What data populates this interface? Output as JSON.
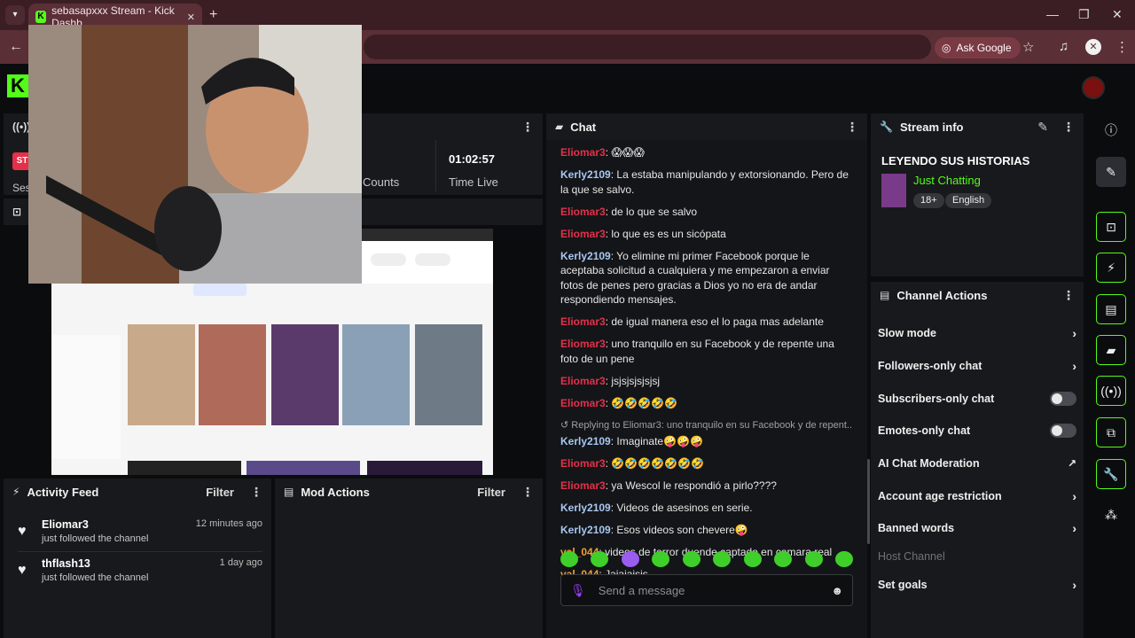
{
  "browser": {
    "tab_title": "sebasapxxx Stream - Kick Dashb",
    "ask_google": "Ask Google"
  },
  "session": {
    "badge": "ST",
    "label_left": "Ses",
    "counts_label": "Counts",
    "time_value": "01:02:57",
    "time_label": "Time Live"
  },
  "chat": {
    "title": "Chat",
    "messages": [
      {
        "user": "Eliomar3",
        "color": "red",
        "text": "😱😱😱"
      },
      {
        "user": "Kerly2109",
        "color": "blue",
        "text": "La estaba manipulando y extorsionando. Pero de la que se salvo."
      },
      {
        "user": "Eliomar3",
        "color": "red",
        "text": "de lo que se salvo"
      },
      {
        "user": "Eliomar3",
        "color": "red",
        "text": "lo que es es un sicópata"
      },
      {
        "user": "Kerly2109",
        "color": "blue",
        "text": "Yo elimine mi primer Facebook porque le aceptaba solicitud a cualquiera y me empezaron a enviar fotos de penes pero gracias a Dios yo no era de andar respondiendo mensajes."
      },
      {
        "user": "Eliomar3",
        "color": "red",
        "text": "de igual manera eso el lo paga mas adelante"
      },
      {
        "user": "Eliomar3",
        "color": "red",
        "text": "uno tranquilo en su Facebook y de repente una foto de un pene"
      },
      {
        "user": "Eliomar3",
        "color": "red",
        "text": "jsjsjsjsjsjsj"
      },
      {
        "user": "Eliomar3",
        "color": "red",
        "text": "🤣🤣🤣🤣🤣"
      },
      {
        "reply": "Replying to Eliomar3: uno tranquilo en su Facebook y de repent...",
        "user": "Kerly2109",
        "color": "blue",
        "text": "Imaginate🤪🤪🤪"
      },
      {
        "user": "Eliomar3",
        "color": "red",
        "text": "🤣🤣🤣🤣🤣🤣🤣"
      },
      {
        "user": "Eliomar3",
        "color": "red",
        "text": "ya Wescol le respondió a pirlo????"
      },
      {
        "user": "Kerly2109",
        "color": "blue",
        "text": "Videos de asesinos en serie."
      },
      {
        "user": "Kerly2109",
        "color": "blue",
        "text": "Esos videos son chevere🤪"
      },
      {
        "user": "val_044",
        "color": "orange",
        "text": "videos de terror duende captado en camara real"
      },
      {
        "user": "val_044",
        "color": "orange",
        "text": "Jajajajsjs"
      }
    ],
    "input_placeholder": "Send a message"
  },
  "stream_info": {
    "title": "Stream info",
    "stream_title": "LEYENDO SUS HISTORIAS",
    "category": "Just Chatting",
    "tags": [
      "18+",
      "English"
    ]
  },
  "channel_actions": {
    "title": "Channel Actions",
    "items": [
      {
        "label": "Slow mode",
        "control": "chevron"
      },
      {
        "label": "Followers-only chat",
        "control": "chevron"
      },
      {
        "label": "Subscribers-only chat",
        "control": "toggle"
      },
      {
        "label": "Emotes-only chat",
        "control": "toggle"
      },
      {
        "label": "AI Chat Moderation",
        "control": "external"
      },
      {
        "label": "Account age restriction",
        "control": "chevron"
      },
      {
        "label": "Banned words",
        "control": "chevron"
      },
      {
        "label": "Host Channel",
        "control": "none"
      },
      {
        "label": "Set goals",
        "control": "chevron"
      }
    ]
  },
  "activity_feed": {
    "title": "Activity Feed",
    "filter": "Filter",
    "items": [
      {
        "name": "Eliomar3",
        "time": "12 minutes ago",
        "action": "just followed the channel"
      },
      {
        "name": "thflash13",
        "time": "1 day ago",
        "action": "just followed the channel"
      }
    ]
  },
  "mod_actions": {
    "title": "Mod Actions",
    "filter": "Filter"
  },
  "colors": {
    "kick_green": "#53fc18",
    "user_red": "#e5304a",
    "user_blue": "#a7c7f2",
    "user_orange": "#f0a030"
  }
}
